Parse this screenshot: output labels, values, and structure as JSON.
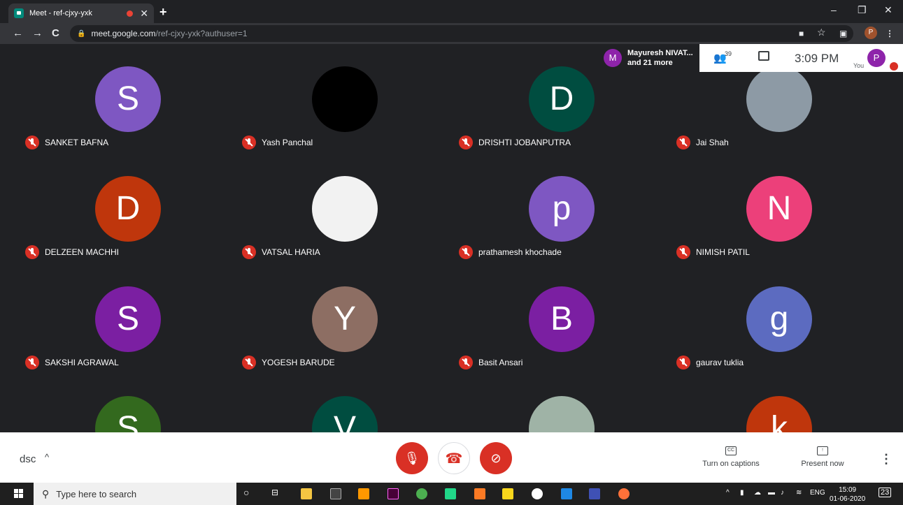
{
  "browser": {
    "tab_title": "Meet - ref-cjxy-yxk",
    "tab_close": "✕",
    "new_tab": "+",
    "minimize": "–",
    "maximize": "❐",
    "close": "✕",
    "back": "←",
    "forward": "→",
    "reload": "C",
    "url_host": "meet.google.com",
    "url_path": "/ref-cjxy-yxk?authuser=1",
    "profile_initial": "P"
  },
  "meet_info": {
    "presenter_initial": "M",
    "presenter_line1": "Mayuresh NIVAT...",
    "presenter_line2": "and 21 more",
    "people_count": "39",
    "time": "3:09 PM",
    "you_initial": "P",
    "you_label": "You"
  },
  "participants": [
    {
      "name": "SANKET BAFNA",
      "initial": "S",
      "color": "#7e57c2",
      "photo": false
    },
    {
      "name": "Yash Panchal",
      "initial": "",
      "color": "#000000",
      "photo": true
    },
    {
      "name": "DRISHTI JOBANPUTRA",
      "initial": "D",
      "color": "#004d40",
      "photo": false
    },
    {
      "name": "Jai Shah",
      "initial": "",
      "color": "#8d9aa5",
      "photo": true
    },
    {
      "name": "DELZEEN MACHHI",
      "initial": "D",
      "color": "#bf360c",
      "photo": false
    },
    {
      "name": "VATSAL HARIA",
      "initial": "",
      "color": "#f2f2f2",
      "photo": true
    },
    {
      "name": "prathamesh khochade",
      "initial": "p",
      "color": "#7e57c2",
      "photo": false
    },
    {
      "name": "NIMISH PATIL",
      "initial": "N",
      "color": "#ec407a",
      "photo": false
    },
    {
      "name": "SAKSHI AGRAWAL",
      "initial": "S",
      "color": "#7b1fa2",
      "photo": false
    },
    {
      "name": "YOGESH BARUDE",
      "initial": "Y",
      "color": "#8d6e63",
      "photo": false
    },
    {
      "name": "Basit Ansari",
      "initial": "B",
      "color": "#7b1fa2",
      "photo": false
    },
    {
      "name": "gaurav tuklia",
      "initial": "g",
      "color": "#5c6bc0",
      "photo": false
    },
    {
      "name": "",
      "initial": "S",
      "color": "#33691e",
      "photo": false
    },
    {
      "name": "",
      "initial": "V",
      "color": "#004d40",
      "photo": false
    },
    {
      "name": "",
      "initial": "",
      "color": "#9fb3a6",
      "photo": true
    },
    {
      "name": "",
      "initial": "k",
      "color": "#bf360c",
      "photo": false
    }
  ],
  "controls": {
    "meeting_code": "dsc",
    "chevron": "^",
    "captions_label": "Turn on captions",
    "present_label": "Present now",
    "more": "⋮"
  },
  "taskbar": {
    "search_placeholder": "Type here to search",
    "lang": "ENG",
    "time": "15:09",
    "date": "01-06-2020",
    "notif_count": "23"
  }
}
